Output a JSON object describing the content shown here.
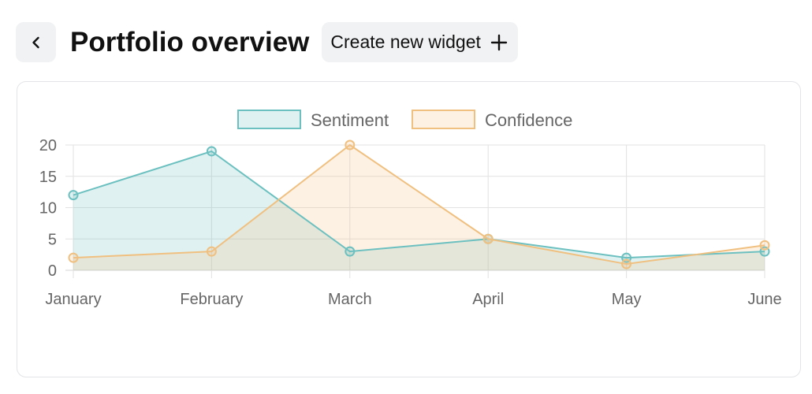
{
  "header": {
    "back_icon": "chevron-left-icon",
    "title": "Portfolio overview",
    "create_button_label": "Create new widget",
    "create_button_icon": "plus-icon"
  },
  "colors": {
    "sentiment_line": "#6cc0c0",
    "sentiment_fill": "rgba(108,192,192,0.22)",
    "confidence_line": "#f0c080",
    "confidence_fill": "rgba(248,190,130,0.22)",
    "grid": "#e2e2e2",
    "axis_text": "#666666"
  },
  "chart_data": {
    "type": "area",
    "categories": [
      "January",
      "February",
      "March",
      "April",
      "May",
      "June"
    ],
    "series": [
      {
        "name": "Sentiment",
        "values": [
          12,
          19,
          3,
          5,
          2,
          3
        ]
      },
      {
        "name": "Confidence",
        "values": [
          2,
          3,
          20,
          5,
          1,
          4
        ]
      }
    ],
    "ylim": [
      0,
      20
    ],
    "yticks": [
      0,
      5,
      10,
      15,
      20
    ],
    "legend": "top-center",
    "grid": true
  }
}
